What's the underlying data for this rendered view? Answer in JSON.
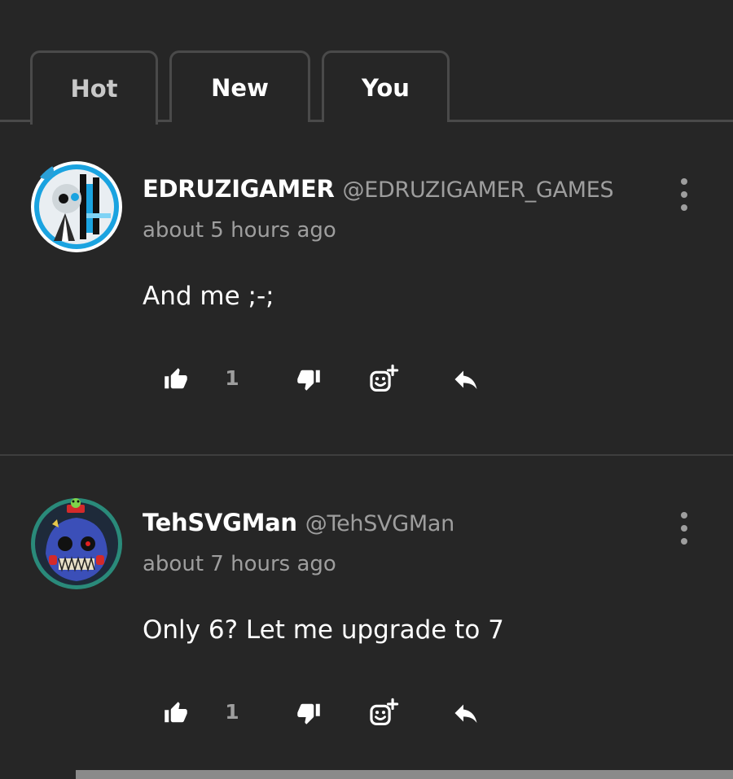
{
  "tabs": [
    {
      "label": "Hot",
      "active": true
    },
    {
      "label": "New",
      "active": false
    },
    {
      "label": "You",
      "active": false
    }
  ],
  "comments": [
    {
      "display_name": "EDRUZIGAMER",
      "handle": "@EDRUZIGAMER_GAMES",
      "timestamp": "about 5 hours ago",
      "text": "And me ;-;",
      "likes": "1",
      "avatar_border_color": "#1aa3e0"
    },
    {
      "display_name": "TehSVGMan",
      "handle": "@TehSVGMan",
      "timestamp": "about 7 hours ago",
      "text": "Only 6? Let me upgrade to 7",
      "likes": "1",
      "avatar_border_color": "#2a8a7a"
    }
  ],
  "icons": {
    "like": "thumbs-up-icon",
    "dislike": "thumbs-down-icon",
    "react": "add-reaction-icon",
    "reply": "reply-icon",
    "more": "more-vertical-icon"
  },
  "colors": {
    "background": "#262626",
    "muted_text": "#9e9e9e",
    "divider": "#3e3e3e",
    "tab_border": "#4a4a4a"
  }
}
